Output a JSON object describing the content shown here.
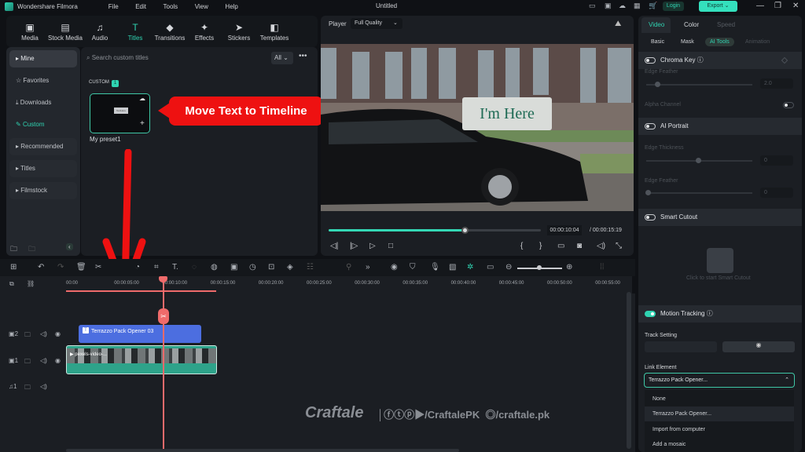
{
  "app": {
    "name": "Wondershare Filmora",
    "document_title": "Untitled",
    "menu": [
      "File",
      "Edit",
      "Tools",
      "View",
      "Help"
    ],
    "login_label": "Login",
    "export_label": "Export"
  },
  "toolbar_tabs": [
    {
      "label": "Media",
      "icon": "media-icon"
    },
    {
      "label": "Stock Media",
      "icon": "stock-media-icon"
    },
    {
      "label": "Audio",
      "icon": "audio-icon"
    },
    {
      "label": "Titles",
      "icon": "titles-icon",
      "active": true
    },
    {
      "label": "Transitions",
      "icon": "transitions-icon"
    },
    {
      "label": "Effects",
      "icon": "effects-icon"
    },
    {
      "label": "Stickers",
      "icon": "stickers-icon"
    },
    {
      "label": "Templates",
      "icon": "templates-icon"
    }
  ],
  "sidebar": {
    "items": [
      "Mine",
      "Favorites",
      "Downloads",
      "Custom",
      "Recommended",
      "Titles",
      "Filmstock"
    ]
  },
  "library": {
    "search_placeholder": "Search custom titles",
    "filter": "All",
    "section_label": "CUSTOM",
    "section_count": "1",
    "preset_name": "My preset1"
  },
  "annotation": {
    "callout": "Move Text to Timeline"
  },
  "player": {
    "label": "Player",
    "quality": "Full Quality",
    "overlay_text": "I'm Here",
    "current_time": "00:00:10:04",
    "total_time": "/ 00:00:15:19",
    "progress": 0.64
  },
  "properties": {
    "tabs": [
      "Video",
      "Color",
      "Speed"
    ],
    "subtabs": [
      "Basic",
      "Mask",
      "AI Tools",
      "Animation"
    ],
    "chroma_key": "Chroma Key",
    "edge_feather": "Edge Feather",
    "edge_feather_val": "2.0",
    "alpha_channel": "Alpha Channel",
    "ai_portrait": "AI Portrait",
    "edge_thickness": "Edge Thickness",
    "edge_thickness_val": "0",
    "edge_feather2": "Edge Feather",
    "edge_feather2_val": "0",
    "smart_cutout": "Smart Cutout",
    "cutout_hint": "Click to start Smart Cutout",
    "motion_tracking": "Motion Tracking",
    "track_setting": "Track Setting",
    "link_element": "Link Element",
    "link_selected": "Terrazzo Pack Opener...",
    "link_options": [
      "None",
      "Terrazzo Pack Opener...",
      "Import from computer",
      "Add a mosaic"
    ]
  },
  "timeline": {
    "ruler": [
      "00:00",
      "00:00:05:00",
      "00:00:10:00",
      "00:00:15:00",
      "00:00:20:00",
      "00:00:25:00",
      "00:00:30:00",
      "00:00:35:00",
      "00:00:40:00",
      "00:00:45:00",
      "00:00:50:00",
      "00:00:55:00"
    ],
    "title_clip": "Terrazzo Pack Opener 03",
    "video_clip": "pexels-video-...",
    "tracks": [
      "2",
      "1",
      "1"
    ]
  },
  "watermark": {
    "brand": "Craftale",
    "handle1": "/CraftalePK",
    "handle2": "/craftale.pk"
  }
}
